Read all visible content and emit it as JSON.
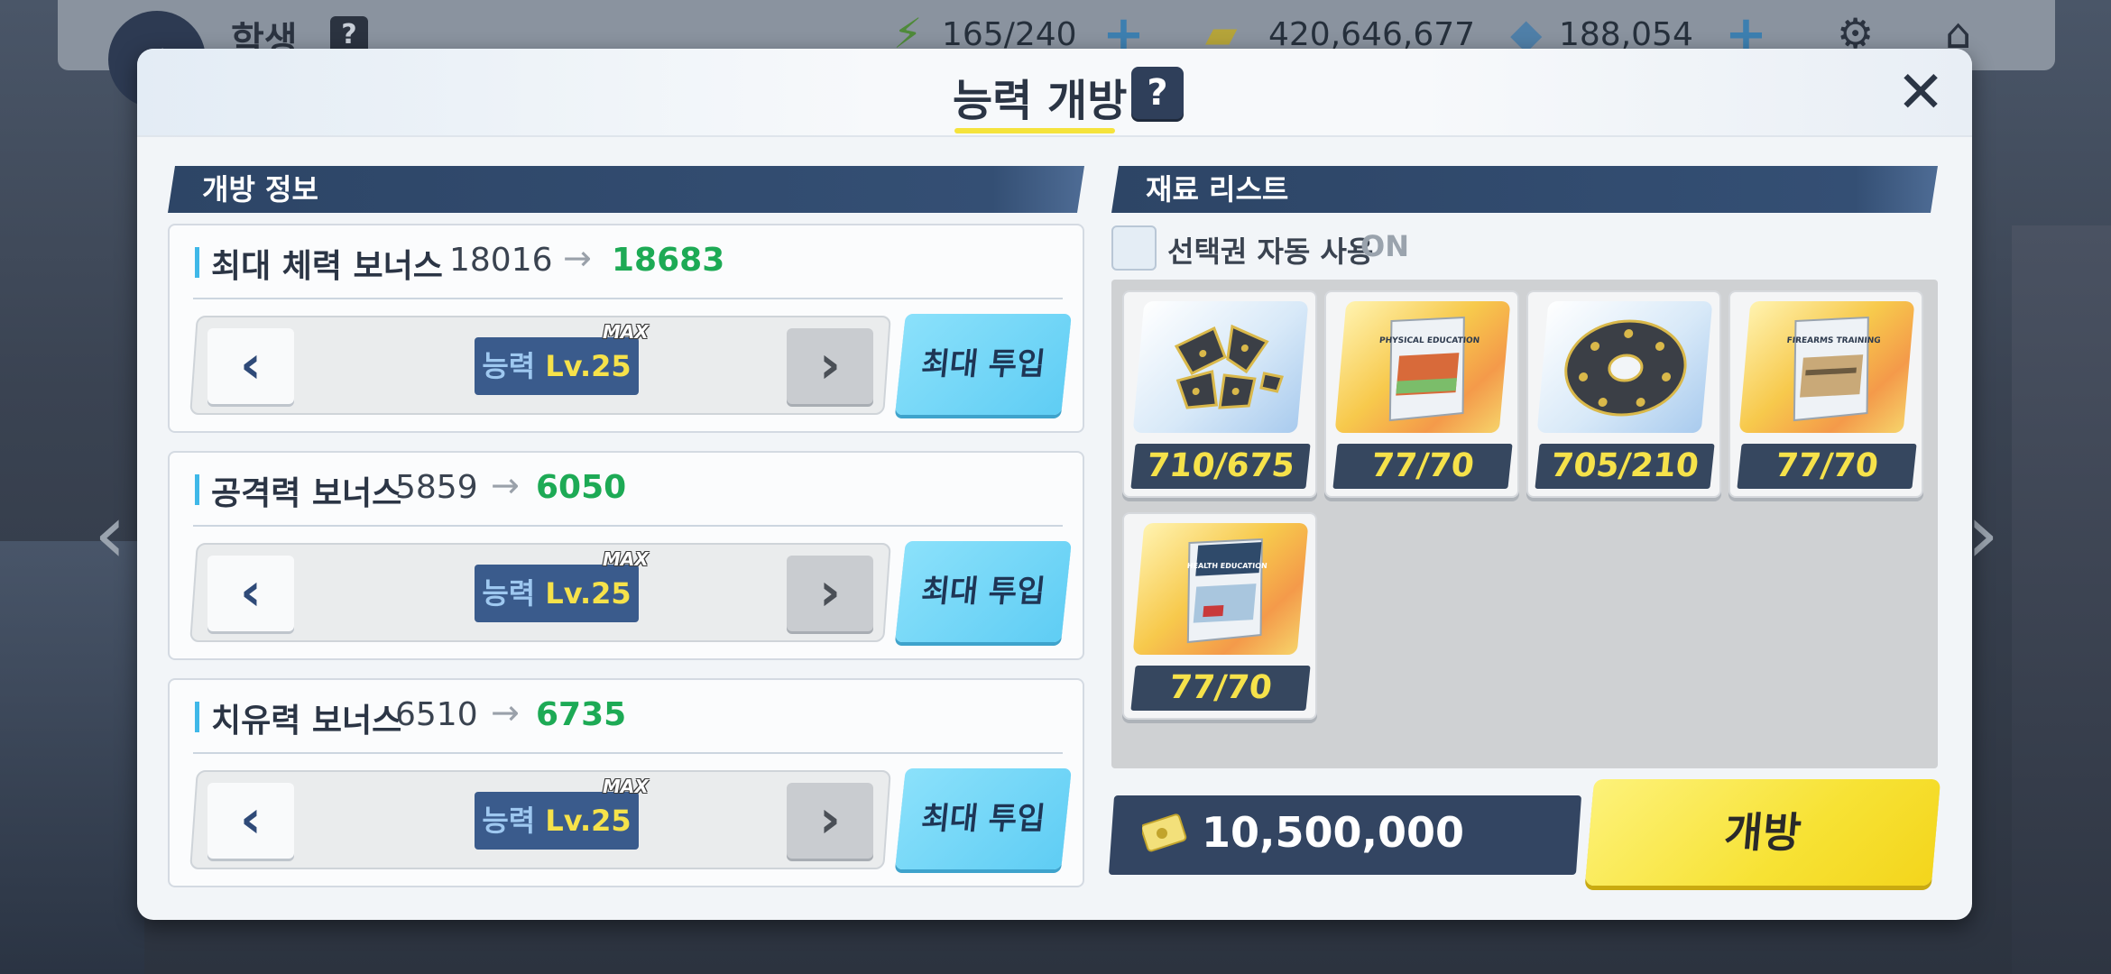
{
  "background": {
    "title": "학생",
    "help": "?",
    "ap": "165/240",
    "credits": "420,646,677",
    "gems": "188,054"
  },
  "modal": {
    "title": "능력 개방",
    "help": "?",
    "close": "✕"
  },
  "info_section": {
    "header": "개방 정보",
    "stats": [
      {
        "label": "최대 체력 보너스",
        "from": "18016",
        "to": "18683",
        "level_prefix": "능력",
        "level": "Lv.25",
        "max_tag": "MAX",
        "max_button": "최대 투입"
      },
      {
        "label": "공격력 보너스",
        "from": "5859",
        "to": "6050",
        "level_prefix": "능력",
        "level": "Lv.25",
        "max_tag": "MAX",
        "max_button": "최대 투입"
      },
      {
        "label": "치유력 보너스",
        "from": "6510",
        "to": "6735",
        "level_prefix": "능력",
        "level": "Lv.25",
        "max_tag": "MAX",
        "max_button": "최대 투입"
      }
    ]
  },
  "material_section": {
    "header": "재료 리스트",
    "auto_label": "선택권 자동 사용",
    "auto_state": "ON",
    "items": [
      {
        "name": "gear-fragments",
        "count": "710/675",
        "theme": "blue",
        "icon": "broken-disc-icon"
      },
      {
        "name": "physical-education-book",
        "count": "77/70",
        "theme": "gold",
        "icon": "book-icon",
        "caption": "PHYSICAL EDUCATION"
      },
      {
        "name": "gear-disc",
        "count": "705/210",
        "theme": "blue",
        "icon": "disc-icon"
      },
      {
        "name": "firearms-training-book",
        "count": "77/70",
        "theme": "gold",
        "icon": "book-icon",
        "caption": "FIREARMS TRAINING"
      },
      {
        "name": "health-education-book",
        "count": "77/70",
        "theme": "gold",
        "icon": "book-icon",
        "caption": "HEALTH EDUCATION"
      }
    ]
  },
  "cost": {
    "value": "10,500,000",
    "icon": "credit-card-icon"
  },
  "open_button": "개방",
  "colors": {
    "accent_green": "#1daa55",
    "header_navy": "#2d4566",
    "badge_yellow": "#f6e24a",
    "cyan_button": "#5fcdf4",
    "yellow_button": "#f7e234"
  }
}
